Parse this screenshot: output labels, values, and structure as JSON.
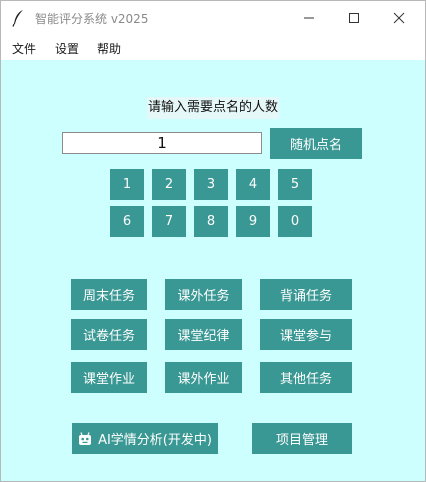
{
  "window": {
    "title": "智能评分系统 v2025",
    "icons": {
      "app": "feather-pen-icon",
      "minimize": "minimize-icon",
      "maximize": "maximize-icon",
      "close": "close-icon"
    }
  },
  "menu": {
    "file": "文件",
    "settings": "设置",
    "help": "帮助"
  },
  "main": {
    "prompt": "请输入需要点名的人数",
    "count_value": "1",
    "random_call_label": "随机点名",
    "keypad_row1": [
      "1",
      "2",
      "3",
      "4",
      "5"
    ],
    "keypad_row2": [
      "6",
      "7",
      "8",
      "9",
      "0"
    ],
    "tasks": [
      [
        "周末任务",
        "课外任务",
        "背诵任务"
      ],
      [
        "试卷任务",
        "课堂纪律",
        "课堂参与"
      ],
      [
        "课堂作业",
        "课外作业",
        "其他任务"
      ]
    ],
    "ai_analysis_label": "AI学情分析(开发中)",
    "ai_icon": "robot-icon",
    "project_manage_label": "项目管理"
  },
  "colors": {
    "window_background": "#ccfffe",
    "button": "#3a9894",
    "button_text": "#ffffff"
  }
}
